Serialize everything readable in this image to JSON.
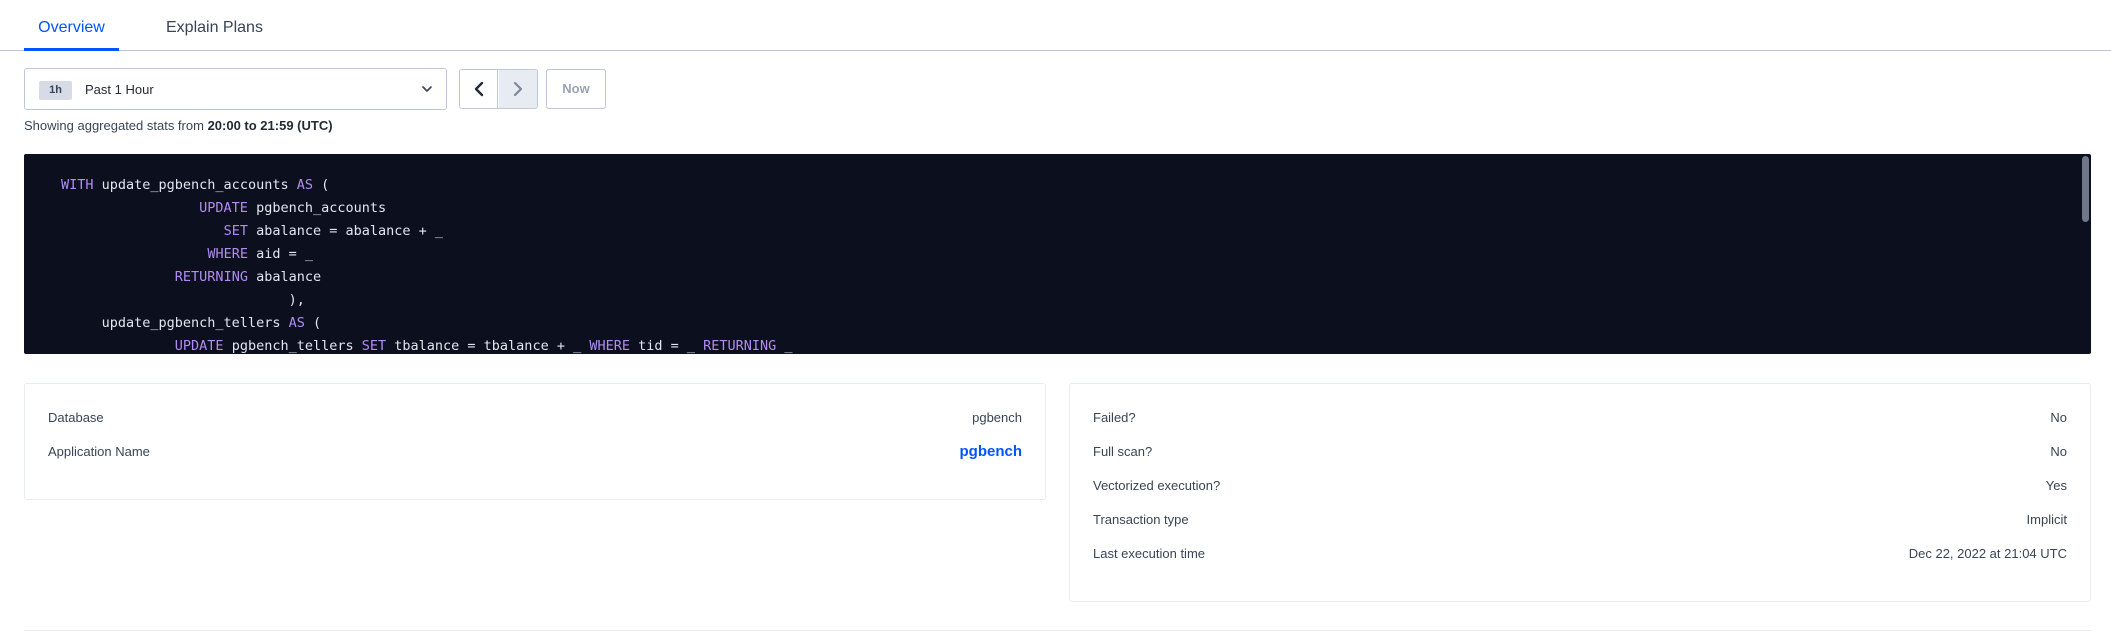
{
  "tabs": [
    {
      "label": "Overview",
      "active": true
    },
    {
      "label": "Explain Plans",
      "active": false
    }
  ],
  "time_range": {
    "badge": "1h",
    "label": "Past 1 Hour",
    "now_label": "Now"
  },
  "aggregated": {
    "prefix": "Showing aggregated stats from ",
    "range": "20:00 to 21:59 (UTC)"
  },
  "sql_lines": [
    [
      {
        "t": "WITH",
        "k": true
      },
      {
        "t": " update_pgbench_accounts "
      },
      {
        "t": "AS",
        "k": true
      },
      {
        "t": " ("
      }
    ],
    [
      {
        "t": "                 "
      },
      {
        "t": "UPDATE",
        "k": true
      },
      {
        "t": " pgbench_accounts"
      }
    ],
    [
      {
        "t": "                    "
      },
      {
        "t": "SET",
        "k": true
      },
      {
        "t": " abalance = abalance + _"
      }
    ],
    [
      {
        "t": "                  "
      },
      {
        "t": "WHERE",
        "k": true
      },
      {
        "t": " aid = _"
      }
    ],
    [
      {
        "t": "              "
      },
      {
        "t": "RETURNING",
        "k": true
      },
      {
        "t": " abalance"
      }
    ],
    [
      {
        "t": "                            ),"
      }
    ],
    [
      {
        "t": "     update_pgbench_tellers "
      },
      {
        "t": "AS",
        "k": true
      },
      {
        "t": " ("
      }
    ],
    [
      {
        "t": "              "
      },
      {
        "t": "UPDATE",
        "k": true
      },
      {
        "t": " pgbench_tellers "
      },
      {
        "t": "SET",
        "k": true
      },
      {
        "t": " tbalance = tbalance + _ "
      },
      {
        "t": "WHERE",
        "k": true
      },
      {
        "t": " tid = _ "
      },
      {
        "t": "RETURNING",
        "k": true
      },
      {
        "t": " _"
      }
    ]
  ],
  "left_stats": [
    {
      "label": "Database",
      "value": "pgbench",
      "link": false
    },
    {
      "label": "Application Name",
      "value": "pgbench",
      "link": true
    }
  ],
  "right_stats": [
    {
      "label": "Failed?",
      "value": "No"
    },
    {
      "label": "Full scan?",
      "value": "No"
    },
    {
      "label": "Vectorized execution?",
      "value": "Yes"
    },
    {
      "label": "Transaction type",
      "value": "Implicit"
    },
    {
      "label": "Last execution time",
      "value": "Dec 22, 2022 at 21:04 UTC"
    }
  ],
  "colors": {
    "accent": "#0055ff",
    "code_bg": "#0b0f1e",
    "keyword": "#b18cf1"
  }
}
